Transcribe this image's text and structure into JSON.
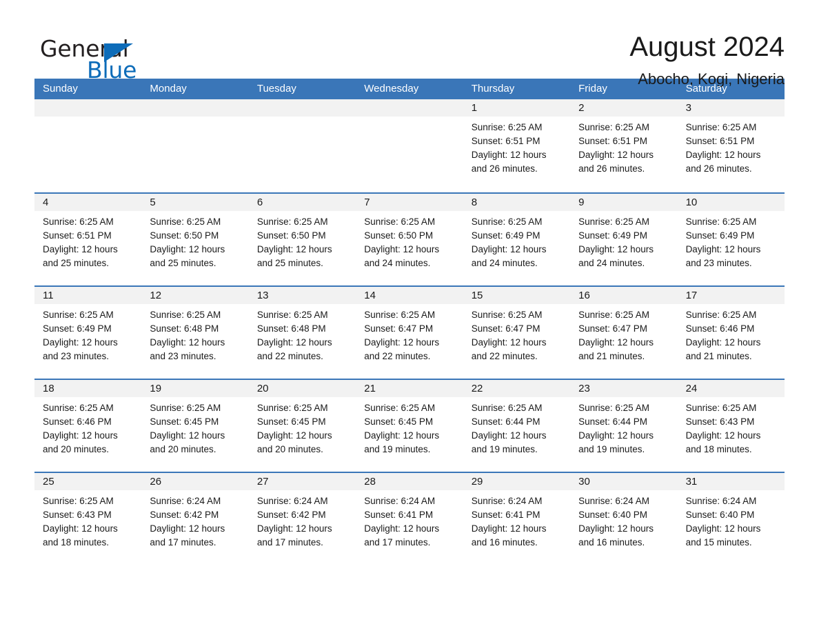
{
  "brand": {
    "name_part1": "General",
    "name_part2": "Blue",
    "logo_icon": "triangle-icon",
    "accent_color": "#0d6cb9"
  },
  "header": {
    "title": "August 2024",
    "subtitle": "Abocho, Kogi, Nigeria"
  },
  "calendar": {
    "header_bg": "#3a76b8",
    "row_divider_color": "#3a76b8",
    "day_band_bg": "#f2f2f2",
    "weekdays": [
      "Sunday",
      "Monday",
      "Tuesday",
      "Wednesday",
      "Thursday",
      "Friday",
      "Saturday"
    ],
    "weeks": [
      [
        {
          "day": "",
          "sunrise": "",
          "sunset": "",
          "daylight": "",
          "empty": true
        },
        {
          "day": "",
          "sunrise": "",
          "sunset": "",
          "daylight": "",
          "empty": true
        },
        {
          "day": "",
          "sunrise": "",
          "sunset": "",
          "daylight": "",
          "empty": true
        },
        {
          "day": "",
          "sunrise": "",
          "sunset": "",
          "daylight": "",
          "empty": true
        },
        {
          "day": "1",
          "sunrise": "Sunrise: 6:25 AM",
          "sunset": "Sunset: 6:51 PM",
          "daylight": "Daylight: 12 hours and 26 minutes.",
          "empty": false
        },
        {
          "day": "2",
          "sunrise": "Sunrise: 6:25 AM",
          "sunset": "Sunset: 6:51 PM",
          "daylight": "Daylight: 12 hours and 26 minutes.",
          "empty": false
        },
        {
          "day": "3",
          "sunrise": "Sunrise: 6:25 AM",
          "sunset": "Sunset: 6:51 PM",
          "daylight": "Daylight: 12 hours and 26 minutes.",
          "empty": false
        }
      ],
      [
        {
          "day": "4",
          "sunrise": "Sunrise: 6:25 AM",
          "sunset": "Sunset: 6:51 PM",
          "daylight": "Daylight: 12 hours and 25 minutes.",
          "empty": false
        },
        {
          "day": "5",
          "sunrise": "Sunrise: 6:25 AM",
          "sunset": "Sunset: 6:50 PM",
          "daylight": "Daylight: 12 hours and 25 minutes.",
          "empty": false
        },
        {
          "day": "6",
          "sunrise": "Sunrise: 6:25 AM",
          "sunset": "Sunset: 6:50 PM",
          "daylight": "Daylight: 12 hours and 25 minutes.",
          "empty": false
        },
        {
          "day": "7",
          "sunrise": "Sunrise: 6:25 AM",
          "sunset": "Sunset: 6:50 PM",
          "daylight": "Daylight: 12 hours and 24 minutes.",
          "empty": false
        },
        {
          "day": "8",
          "sunrise": "Sunrise: 6:25 AM",
          "sunset": "Sunset: 6:49 PM",
          "daylight": "Daylight: 12 hours and 24 minutes.",
          "empty": false
        },
        {
          "day": "9",
          "sunrise": "Sunrise: 6:25 AM",
          "sunset": "Sunset: 6:49 PM",
          "daylight": "Daylight: 12 hours and 24 minutes.",
          "empty": false
        },
        {
          "day": "10",
          "sunrise": "Sunrise: 6:25 AM",
          "sunset": "Sunset: 6:49 PM",
          "daylight": "Daylight: 12 hours and 23 minutes.",
          "empty": false
        }
      ],
      [
        {
          "day": "11",
          "sunrise": "Sunrise: 6:25 AM",
          "sunset": "Sunset: 6:49 PM",
          "daylight": "Daylight: 12 hours and 23 minutes.",
          "empty": false
        },
        {
          "day": "12",
          "sunrise": "Sunrise: 6:25 AM",
          "sunset": "Sunset: 6:48 PM",
          "daylight": "Daylight: 12 hours and 23 minutes.",
          "empty": false
        },
        {
          "day": "13",
          "sunrise": "Sunrise: 6:25 AM",
          "sunset": "Sunset: 6:48 PM",
          "daylight": "Daylight: 12 hours and 22 minutes.",
          "empty": false
        },
        {
          "day": "14",
          "sunrise": "Sunrise: 6:25 AM",
          "sunset": "Sunset: 6:47 PM",
          "daylight": "Daylight: 12 hours and 22 minutes.",
          "empty": false
        },
        {
          "day": "15",
          "sunrise": "Sunrise: 6:25 AM",
          "sunset": "Sunset: 6:47 PM",
          "daylight": "Daylight: 12 hours and 22 minutes.",
          "empty": false
        },
        {
          "day": "16",
          "sunrise": "Sunrise: 6:25 AM",
          "sunset": "Sunset: 6:47 PM",
          "daylight": "Daylight: 12 hours and 21 minutes.",
          "empty": false
        },
        {
          "day": "17",
          "sunrise": "Sunrise: 6:25 AM",
          "sunset": "Sunset: 6:46 PM",
          "daylight": "Daylight: 12 hours and 21 minutes.",
          "empty": false
        }
      ],
      [
        {
          "day": "18",
          "sunrise": "Sunrise: 6:25 AM",
          "sunset": "Sunset: 6:46 PM",
          "daylight": "Daylight: 12 hours and 20 minutes.",
          "empty": false
        },
        {
          "day": "19",
          "sunrise": "Sunrise: 6:25 AM",
          "sunset": "Sunset: 6:45 PM",
          "daylight": "Daylight: 12 hours and 20 minutes.",
          "empty": false
        },
        {
          "day": "20",
          "sunrise": "Sunrise: 6:25 AM",
          "sunset": "Sunset: 6:45 PM",
          "daylight": "Daylight: 12 hours and 20 minutes.",
          "empty": false
        },
        {
          "day": "21",
          "sunrise": "Sunrise: 6:25 AM",
          "sunset": "Sunset: 6:45 PM",
          "daylight": "Daylight: 12 hours and 19 minutes.",
          "empty": false
        },
        {
          "day": "22",
          "sunrise": "Sunrise: 6:25 AM",
          "sunset": "Sunset: 6:44 PM",
          "daylight": "Daylight: 12 hours and 19 minutes.",
          "empty": false
        },
        {
          "day": "23",
          "sunrise": "Sunrise: 6:25 AM",
          "sunset": "Sunset: 6:44 PM",
          "daylight": "Daylight: 12 hours and 19 minutes.",
          "empty": false
        },
        {
          "day": "24",
          "sunrise": "Sunrise: 6:25 AM",
          "sunset": "Sunset: 6:43 PM",
          "daylight": "Daylight: 12 hours and 18 minutes.",
          "empty": false
        }
      ],
      [
        {
          "day": "25",
          "sunrise": "Sunrise: 6:25 AM",
          "sunset": "Sunset: 6:43 PM",
          "daylight": "Daylight: 12 hours and 18 minutes.",
          "empty": false
        },
        {
          "day": "26",
          "sunrise": "Sunrise: 6:24 AM",
          "sunset": "Sunset: 6:42 PM",
          "daylight": "Daylight: 12 hours and 17 minutes.",
          "empty": false
        },
        {
          "day": "27",
          "sunrise": "Sunrise: 6:24 AM",
          "sunset": "Sunset: 6:42 PM",
          "daylight": "Daylight: 12 hours and 17 minutes.",
          "empty": false
        },
        {
          "day": "28",
          "sunrise": "Sunrise: 6:24 AM",
          "sunset": "Sunset: 6:41 PM",
          "daylight": "Daylight: 12 hours and 17 minutes.",
          "empty": false
        },
        {
          "day": "29",
          "sunrise": "Sunrise: 6:24 AM",
          "sunset": "Sunset: 6:41 PM",
          "daylight": "Daylight: 12 hours and 16 minutes.",
          "empty": false
        },
        {
          "day": "30",
          "sunrise": "Sunrise: 6:24 AM",
          "sunset": "Sunset: 6:40 PM",
          "daylight": "Daylight: 12 hours and 16 minutes.",
          "empty": false
        },
        {
          "day": "31",
          "sunrise": "Sunrise: 6:24 AM",
          "sunset": "Sunset: 6:40 PM",
          "daylight": "Daylight: 12 hours and 15 minutes.",
          "empty": false
        }
      ]
    ]
  }
}
